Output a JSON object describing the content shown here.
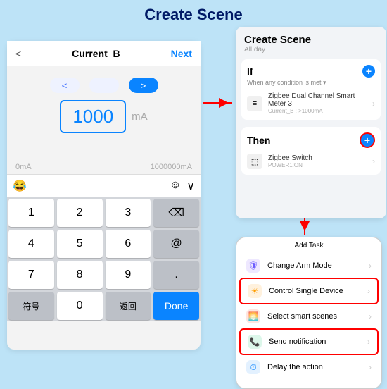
{
  "title": "Create Scene",
  "panelA": {
    "back": "<",
    "title": "Current_B",
    "next": "Next",
    "ops": [
      "<",
      "=",
      ">"
    ],
    "selected_op_index": 2,
    "value": "1000",
    "unit": "mA",
    "min": "0mA",
    "max": "1000000mA",
    "keys": [
      [
        "1",
        "2",
        "3",
        "⌫"
      ],
      [
        "4",
        "5",
        "6",
        "@"
      ],
      [
        "7",
        "8",
        "9",
        "."
      ],
      [
        "符号",
        "0",
        "返回",
        "Done"
      ]
    ]
  },
  "panelB": {
    "title": "Create Scene",
    "subtitle": "All day",
    "if": {
      "title": "If",
      "cond": "When any condition is met ▾",
      "item_line1": "Zigbee Dual Channel Smart Meter 3",
      "item_line2": "Current_B : >1000mA"
    },
    "then": {
      "title": "Then",
      "item_line1": "Zigbee Switch",
      "item_line2": "POWER1:ON"
    }
  },
  "panelC": {
    "title": "Add Task",
    "items": [
      {
        "icon": "🛡",
        "color": "#6b5cff",
        "bg": "#eee8ff",
        "label": "Change Arm Mode",
        "hl": false
      },
      {
        "icon": "☀",
        "color": "#ff9d00",
        "bg": "#fff1dd",
        "label": "Control Single Device",
        "hl": true
      },
      {
        "icon": "🌅",
        "color": "#ff5b37",
        "bg": "#ffe5df",
        "label": "Select smart scenes",
        "hl": false
      },
      {
        "icon": "📞",
        "color": "#18c26b",
        "bg": "#dcf7ea",
        "label": "Send notification",
        "hl": true
      },
      {
        "icon": "⏱",
        "color": "#0a84ff",
        "bg": "#e3f1ff",
        "label": "Delay the action",
        "hl": false
      }
    ]
  }
}
